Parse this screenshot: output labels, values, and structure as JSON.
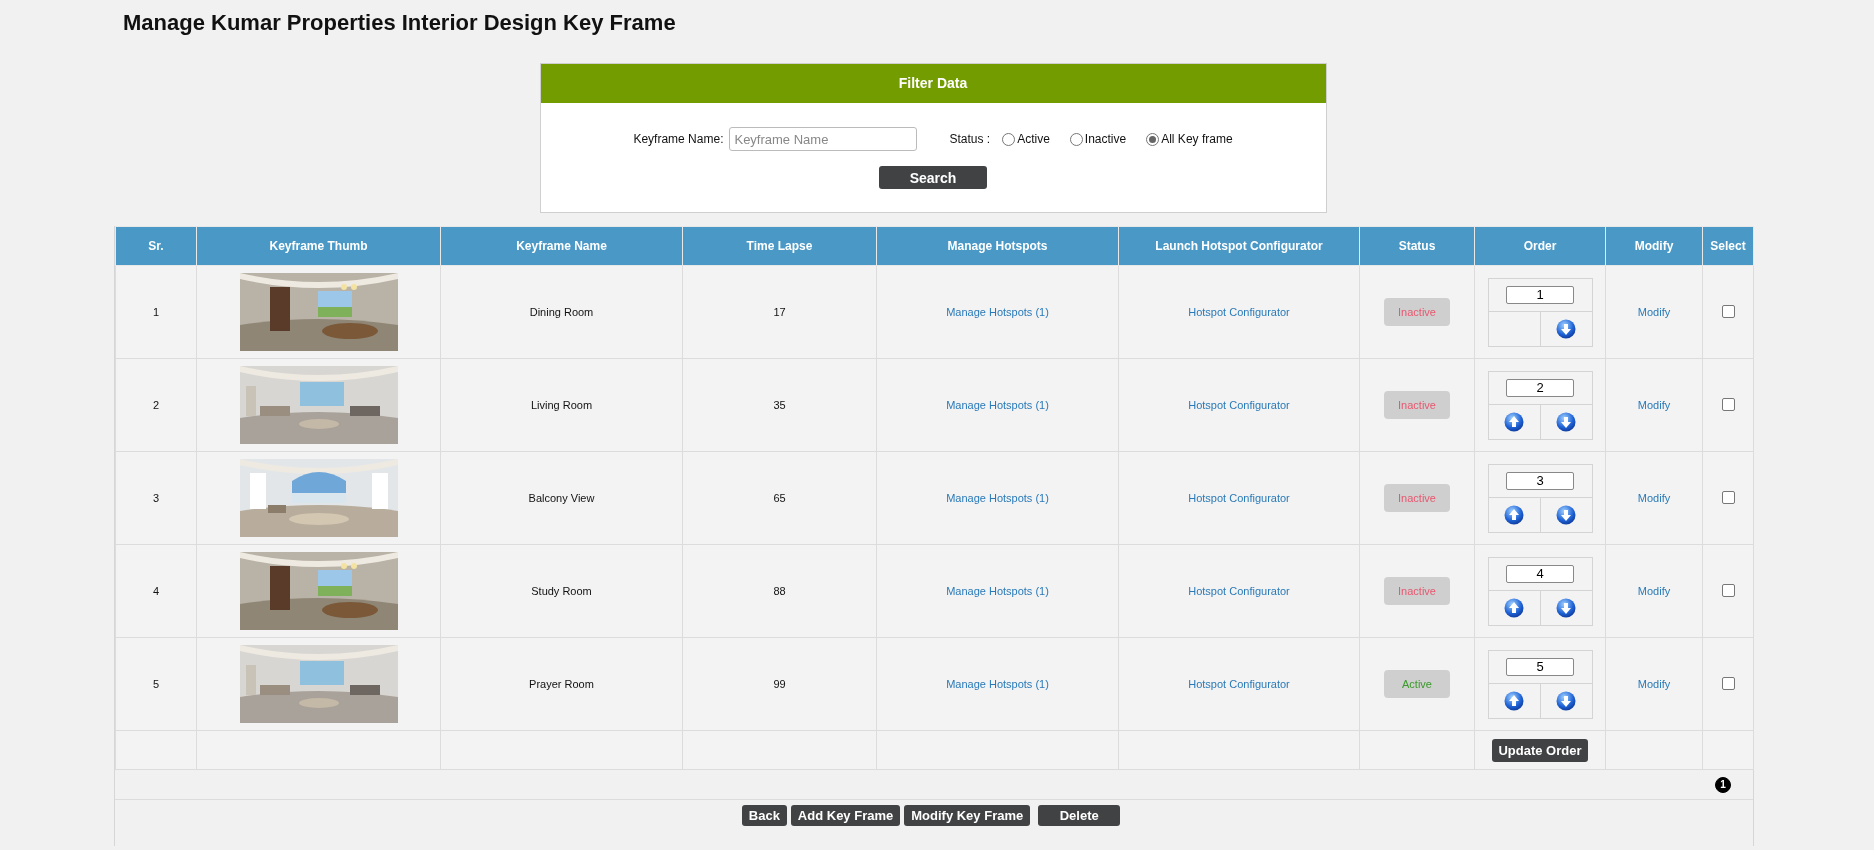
{
  "page_title": "Manage Kumar Properties Interior Design Key Frame",
  "filter": {
    "title": "Filter Data",
    "name_label": "Keyframe Name:",
    "name_field": {
      "placeholder": "Keyframe Name"
    },
    "status_label": "Status :",
    "status_options": [
      {
        "label": "Active",
        "selected": false
      },
      {
        "label": "Inactive",
        "selected": false
      },
      {
        "label": "All Key frame",
        "selected": true
      }
    ],
    "search_button": "Search"
  },
  "table": {
    "columns": [
      "Sr.",
      "Keyframe Thumb",
      "Keyframe Name",
      "Time Lapse",
      "Manage Hotspots",
      "Launch Hotspot Configurator",
      "Status",
      "Order",
      "Modify",
      "Select"
    ],
    "rows": [
      {
        "sr": "1",
        "name": "Dining Room",
        "time_lapse": "17",
        "manage_hotspots": "Manage Hotspots (1)",
        "configurator": "Hotspot Configurator",
        "status": {
          "label": "Inactive",
          "kind": "inactive"
        },
        "order": {
          "value": "1",
          "up": false,
          "down": true
        },
        "modify": "Modify",
        "checked": false
      },
      {
        "sr": "2",
        "name": "Living Room",
        "time_lapse": "35",
        "manage_hotspots": "Manage Hotspots (1)",
        "configurator": "Hotspot Configurator",
        "status": {
          "label": "Inactive",
          "kind": "inactive"
        },
        "order": {
          "value": "2",
          "up": true,
          "down": true
        },
        "modify": "Modify",
        "checked": false
      },
      {
        "sr": "3",
        "name": "Balcony View",
        "time_lapse": "65",
        "manage_hotspots": "Manage Hotspots (1)",
        "configurator": "Hotspot Configurator",
        "status": {
          "label": "Inactive",
          "kind": "inactive"
        },
        "order": {
          "value": "3",
          "up": true,
          "down": true
        },
        "modify": "Modify",
        "checked": false
      },
      {
        "sr": "4",
        "name": "Study Room",
        "time_lapse": "88",
        "manage_hotspots": "Manage Hotspots (1)",
        "configurator": "Hotspot Configurator",
        "status": {
          "label": "Inactive",
          "kind": "inactive"
        },
        "order": {
          "value": "4",
          "up": true,
          "down": true
        },
        "modify": "Modify",
        "checked": false
      },
      {
        "sr": "5",
        "name": "Prayer Room",
        "time_lapse": "99",
        "manage_hotspots": "Manage Hotspots (1)",
        "configurator": "Hotspot Configurator",
        "status": {
          "label": "Active",
          "kind": "active"
        },
        "order": {
          "value": "5",
          "up": true,
          "down": true
        },
        "modify": "Modify",
        "checked": false
      }
    ],
    "update_order_button": "Update Order",
    "pages": [
      {
        "label": "1",
        "selected": true
      }
    ]
  },
  "actions": [
    "Back",
    "Add Key Frame",
    "Modify Key Frame",
    "Delete"
  ]
}
